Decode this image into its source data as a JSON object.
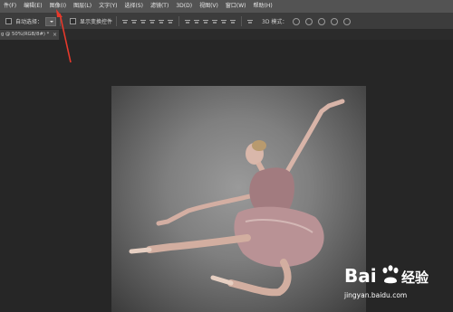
{
  "menu": {
    "items": [
      "件(F)",
      "编辑(E)",
      "图像(I)",
      "图层(L)",
      "文字(Y)",
      "选择(S)",
      "滤镜(T)",
      "3D(D)",
      "视图(V)",
      "窗口(W)",
      "帮助(H)"
    ]
  },
  "options": {
    "auto_select_label": "自动选择：",
    "show_transform_label": "显示变换控件",
    "mode_3d_label": "3D 模式："
  },
  "document": {
    "tab_title": "g @ 50%(RGB/8#) *",
    "close_glyph": "×"
  },
  "watermark": {
    "logo_left": "Bai",
    "logo_right": "经验",
    "url": "jingyan.baidu.com"
  },
  "annotation": {
    "arrow_color": "#e8392b"
  }
}
